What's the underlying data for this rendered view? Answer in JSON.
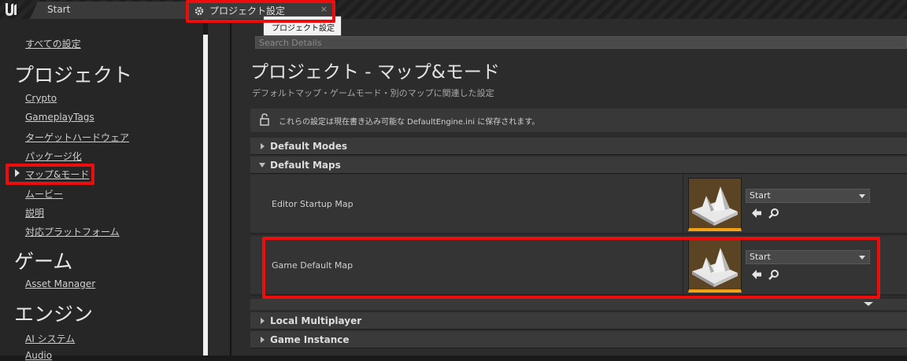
{
  "tabs": {
    "start_label": "Start",
    "project_settings_label": "プロジェクト設定",
    "close_label": "×"
  },
  "tooltip": {
    "text": "プロジェクト設定"
  },
  "sidebar": {
    "all_settings": "すべての設定",
    "project_heading": "プロジェクト",
    "project_items": [
      "Crypto",
      "GameplayTags",
      "ターゲットハードウェア",
      "パッケージ化",
      "マップ&モード",
      "ムービー",
      "説明",
      "対応プラットフォーム"
    ],
    "game_heading": "ゲーム",
    "game_items": [
      "Asset Manager"
    ],
    "engine_heading": "エンジン",
    "engine_items": [
      "AI システム",
      "Audio"
    ]
  },
  "search": {
    "placeholder": "Search Details"
  },
  "page": {
    "title": "プロジェクト - マップ&モード",
    "subtitle": "デフォルトマップ・ゲームモード・別のマップに関連した設定",
    "info": "これらの設定は現在書き込み可能な DefaultEngine.ini に保存されます。"
  },
  "sections": {
    "default_modes": "Default Modes",
    "default_maps": "Default Maps",
    "local_multiplayer": "Local Multiplayer",
    "game_instance": "Game Instance"
  },
  "rows": [
    {
      "label": "Editor Startup Map",
      "value": "Start"
    },
    {
      "label": "Game Default Map",
      "value": "Start"
    }
  ],
  "colors": {
    "highlight": "#ee0d0d",
    "thumbnail_accent": "#f1a217",
    "background": "#2c2c2c"
  }
}
